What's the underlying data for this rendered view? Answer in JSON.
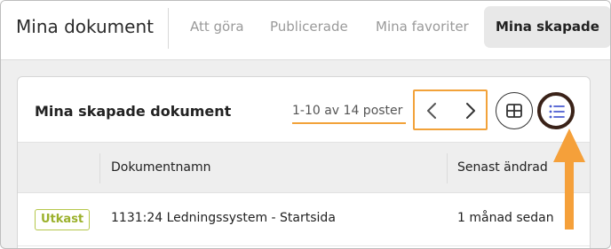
{
  "header": {
    "title": "Mina dokument",
    "tabs": [
      {
        "label": "Att göra",
        "active": false
      },
      {
        "label": "Publicerade",
        "active": false
      },
      {
        "label": "Mina favoriter",
        "active": false
      },
      {
        "label": "Mina skapade",
        "active": true
      }
    ]
  },
  "card": {
    "title": "Mina skapade dokument",
    "pagination": {
      "range_label": "1-10 av 14 poster",
      "prev_icon": "chevron-left-icon",
      "next_icon": "chevron-right-icon"
    },
    "view_toggle": {
      "grid_icon": "grid-view-icon",
      "list_icon": "list-view-icon",
      "selected": "list"
    },
    "table": {
      "columns": [
        "",
        "Dokumentnamn",
        "Senast ändrad"
      ],
      "rows": [
        {
          "status": "Utkast",
          "name": "1131:24 Ledningssystem - Startsida",
          "modified": "1 månad sedan"
        }
      ]
    }
  },
  "colors": {
    "highlight": "#f2a23a",
    "draft_badge": "#9bb12c",
    "active_ring": "#3a2218",
    "list_icon": "#4a5bd0"
  }
}
